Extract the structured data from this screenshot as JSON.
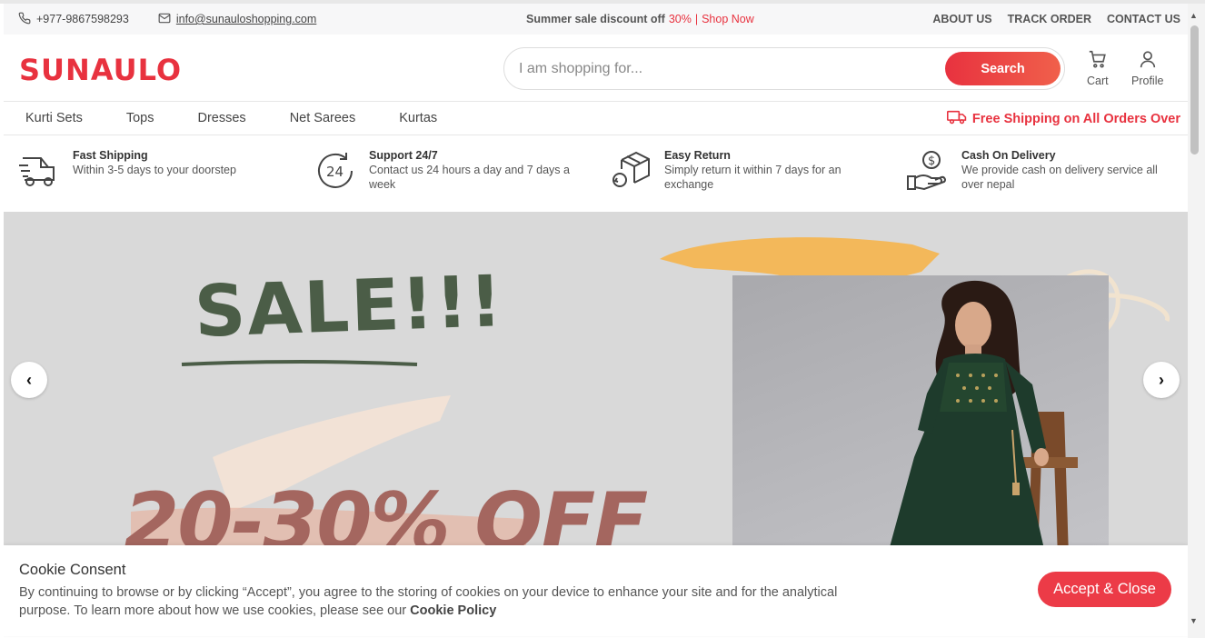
{
  "topbar": {
    "phone": "+977-9867598293",
    "email": "info@sunauloshopping.com",
    "promo_text": "Summer sale discount off",
    "promo_percent": "30%",
    "promo_sep": "|",
    "promo_link": "Shop Now",
    "links": [
      "ABOUT US",
      "TRACK ORDER",
      "CONTACT US"
    ]
  },
  "header": {
    "logo": "SUNAULO",
    "search_placeholder": "I am shopping for...",
    "search_button": "Search",
    "cart_label": "Cart",
    "profile_label": "Profile"
  },
  "nav": {
    "items": [
      "Kurti Sets",
      "Tops",
      "Dresses",
      "Net Sarees",
      "Kurtas"
    ],
    "free_shipping": "Free Shipping on All Orders Over"
  },
  "features": [
    {
      "title": "Fast Shipping",
      "desc": "Within 3-5 days to your doorstep",
      "icon": "truck-icon"
    },
    {
      "title": "Support 24/7",
      "desc": "Contact us 24 hours a day and 7 days a week",
      "icon": "support-24-icon"
    },
    {
      "title": "Easy Return",
      "desc": "Simply return it within 7 days for an exchange",
      "icon": "return-box-icon"
    },
    {
      "title": "Cash On Delivery",
      "desc": "We provide cash on delivery service all over nepal",
      "icon": "cash-hand-icon"
    }
  ],
  "hero": {
    "sale": "SALE!!!",
    "discount": "20-30% OFF"
  },
  "cookie": {
    "title": "Cookie Consent",
    "body": "By continuing to browse or by clicking “Accept”, you agree to the storing of cookies on your device to enhance your site and for the analytical purpose. To learn more about how we use cookies, please see our",
    "policy_link": "Cookie Policy",
    "accept_button": "Accept & Close"
  },
  "colors": {
    "accent": "#e8323f",
    "hero_bg": "#d9d9d9",
    "sale_green": "#4b5d47",
    "off_brown": "#a4665f",
    "dress_green": "#1e3b2c"
  }
}
